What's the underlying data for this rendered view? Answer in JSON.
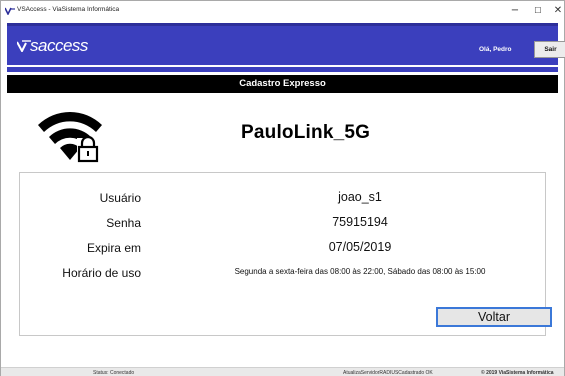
{
  "window": {
    "title": "VSAccess - ViaSistema Informática",
    "minimize_glyph": "−",
    "maximize_glyph": "☐",
    "close_glyph": "✕"
  },
  "header": {
    "logo_text": "saccess",
    "greeting": "Olá, Pedro",
    "logout_label": "Sair",
    "brand_color": "#3b3fbd"
  },
  "section": {
    "title": "Cadastro Expresso"
  },
  "network": {
    "icon": "wifi-lock-icon",
    "ssid": "PauloLink_5G"
  },
  "details": {
    "user_label": "Usuário",
    "user_value": "joao_s1",
    "password_label": "Senha",
    "password_value": "75915194",
    "expires_label": "Expira em",
    "expires_value": "07/05/2019",
    "schedule_label": "Horário de uso",
    "schedule_value": "Segunda a sexta-feira das 08:00 às 22:00, Sábado das 08:00 às 15:00"
  },
  "actions": {
    "back_label": "Voltar"
  },
  "status": {
    "connection": "Status: Conectado",
    "server_sync": "AtualizaServidorRADIUSCadastrado OK",
    "copyright": "© 2019 ViaSistema Informática"
  }
}
